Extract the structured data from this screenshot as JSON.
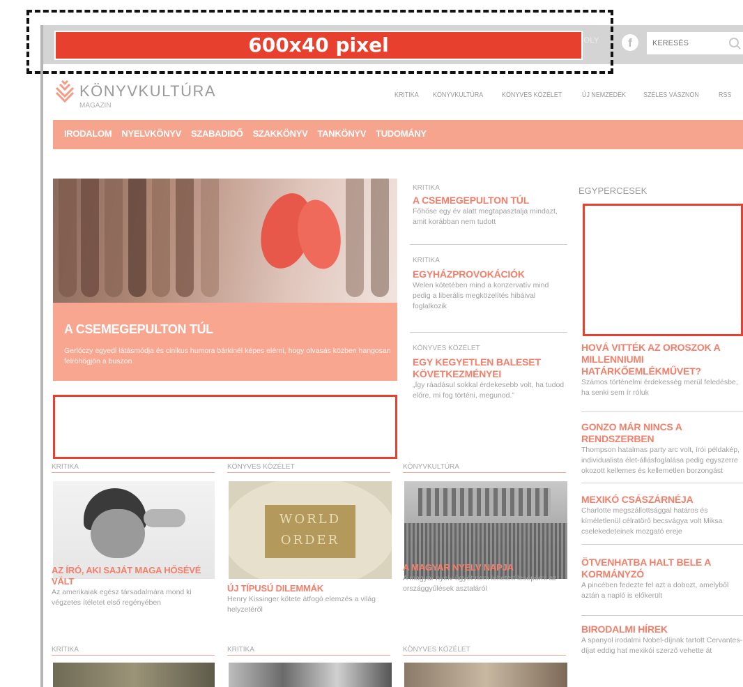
{
  "ad_banner": {
    "label": "600x40 pixel"
  },
  "topbar": {
    "link_partial": "ZSGOLY",
    "facebook": "f",
    "search_placeholder": "KERESÉS"
  },
  "logo": {
    "name": "KÖNYVKULTÚRA",
    "sub": "MAGAZIN"
  },
  "top_nav": [
    "KRITIKA",
    "KÖNYVKULTÚRA",
    "KÖNYVES KÖZÉLET",
    "ÚJ NEMZEDÉK",
    "SZÉLES VÁSZNON",
    "RSS"
  ],
  "category_nav": [
    "IRODALOM",
    "NYELVKÖNYV",
    "SZABADIDŐ",
    "SZAKKÖNYV",
    "TANKÖNYV",
    "TUDOMÁNY"
  ],
  "hero": {
    "title": "A CSEMEGEPULTON TÚL",
    "desc": "Gerlóczy egyedi látásmódja és cinikus humora bárkinél képes elérni, hogy olvasás közben hangosan felröhögjön a buszon"
  },
  "mid_articles": [
    {
      "cat": "KRITIKA",
      "title": "A CSEMEGEPULTON TÚL",
      "desc": "Főhőse egy év alatt megtapasztalja mindazt, amit korábban nem tudott"
    },
    {
      "cat": "KRITIKA",
      "title": "EGYHÁZPROVOKÁCIÓK",
      "desc": "Welen kötetében mind a konzervatív mind pedig a liberális megközelítés hibáival foglalkozik"
    },
    {
      "cat": "KÖNYVES KÖZÉLET",
      "title": "EGY KEGYETLEN BALESET KÖVETKEZMÉNYEI",
      "desc": "„Így ráadásul sokkal érdekesebb volt, ha tudod előre, mi fog történi, megunod.”"
    }
  ],
  "right": {
    "heading": "EGYPERCESEK",
    "items": [
      {
        "title": "HOVÁ VITTÉK AZ OROSZOK A MILLENNIUMI HATÁRKŐEMLÉKMŰVET?",
        "desc": "Számos történelmi érdekesség merül feledésbe, ha senki sem ír róluk"
      },
      {
        "title": "GONZO MÁR NINCS A RENDSZERBEN",
        "desc": "Thompson hatalmas party arc volt, írói példakép, individualista élet-állásfoglalása pedig egyszerre okozott kellemes és kellemetlen borzongást"
      },
      {
        "title": "MEXIKÓ CSÁSZÁRNÉJA",
        "desc": "Charlotte megszállottsággal határos és kíméletlenül célratörő becsvágya volt Miksa cselekedeteinek mozgató ereje"
      },
      {
        "title": "ÖTVENHATBA HALT BELE A KORMÁNYZÓ",
        "desc": "A pincében fedezte fel azt a dobozt, amelyből aztán a napló is előkerült"
      },
      {
        "title": "BIRODALMI HÍREK",
        "desc": "A spanyol irodalmi Nobel-díjnak tartott Cervantes-díjat eddig hat mexikói szerző vehette át"
      }
    ]
  },
  "cards": [
    {
      "cat": "KRITIKA",
      "title": "AZ ÍRÓ, AKI SAJÁT MAGA HŐSÉVÉ VÁLT",
      "desc": "Az amerikaiak egész társadalmára mond ki végzetes ítéletet első regényében"
    },
    {
      "cat": "KÖNYVES KÖZÉLET",
      "title": "ÚJ TÍPUSÚ DILEMMÁK",
      "desc": "Henry Kissinger kötete átfogó elemzés a világ helyzetéről",
      "image_text": "WORLD ORDER"
    },
    {
      "cat": "KÖNYVKULTÚRA",
      "title": "A MAGYAR NYELV NAPJA",
      "desc": "A magyar nyelv ügyét nem lehetett lesöpörni az országgyűlések asztaláról"
    }
  ],
  "bottom_cats": [
    "KRITIKA",
    "KRITIKA",
    "KÖNYVES KÖZÉLET"
  ]
}
